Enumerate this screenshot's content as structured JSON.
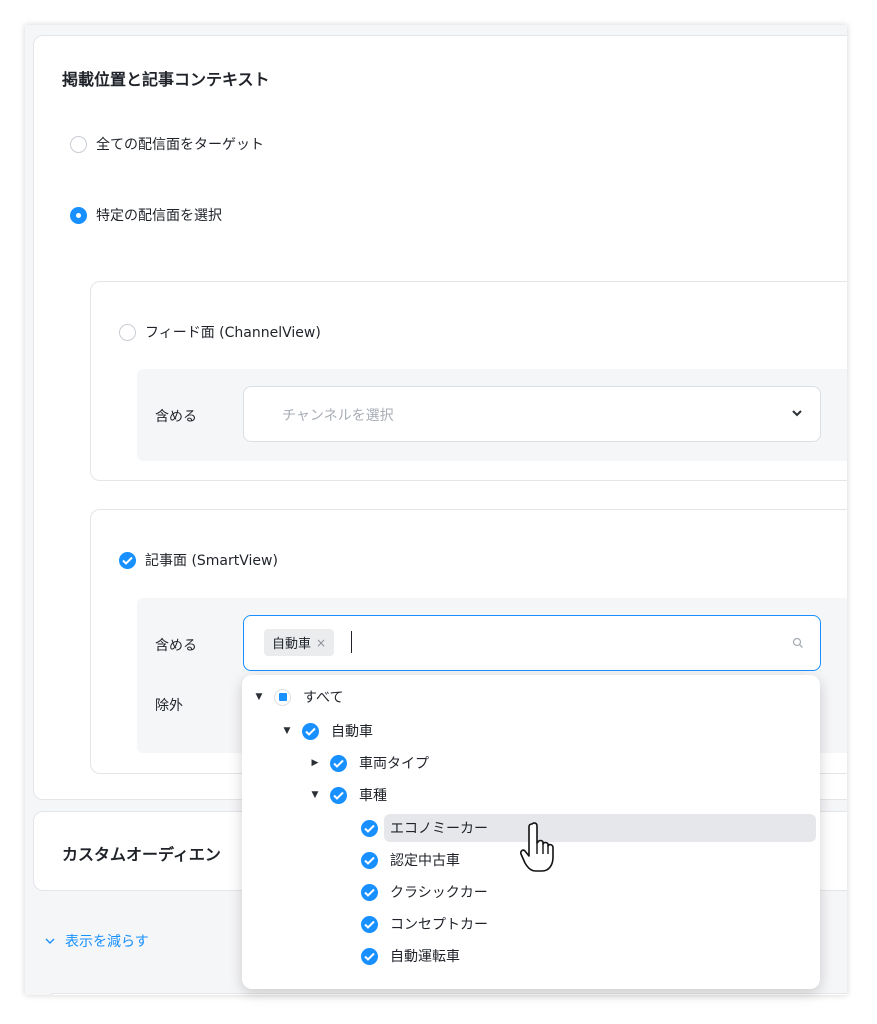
{
  "section": {
    "title": "掲載位置と記事コンテキスト",
    "radio_all": "全ての配信面をターゲット",
    "radio_specific": "特定の配信面を選択"
  },
  "feed": {
    "label": "フィード面 (ChannelView)",
    "include_label": "含める",
    "channel_placeholder": "チャンネルを選択"
  },
  "article": {
    "label": "記事面 (SmartView)",
    "include_label": "含める",
    "exclude_label": "除外",
    "selected_tag": "自動車",
    "tag_remove": "×"
  },
  "custom_audience": {
    "title": "カスタムオーディエン"
  },
  "collapse": {
    "label": "表示を減らす"
  },
  "tree": {
    "all": "すべて",
    "auto": "自動車",
    "vehicle_type": "車両タイプ",
    "car_model": "車種",
    "children": [
      "エコノミーカー",
      "認定中古車",
      "クラシックカー",
      "コンセプトカー",
      "自動運転車"
    ]
  },
  "colors": {
    "accent": "#1890ff",
    "hover": "#e6e7ea",
    "panel_bg": "#f5f6f8"
  }
}
